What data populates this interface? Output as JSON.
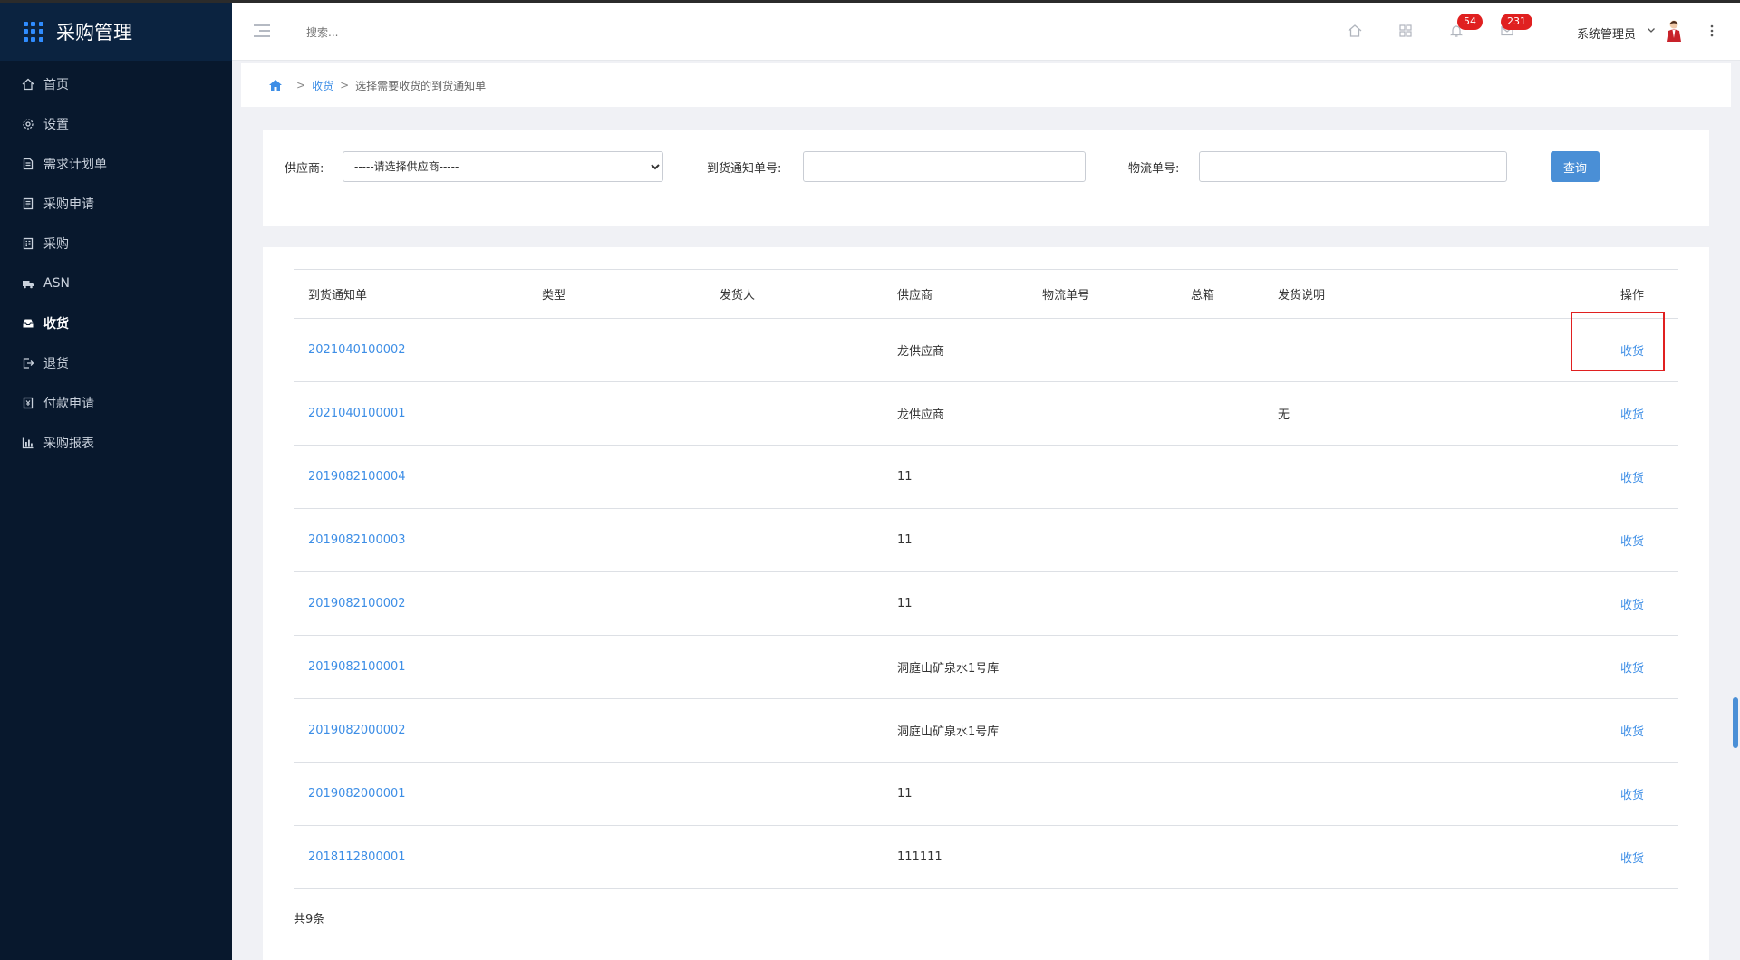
{
  "app": {
    "title": "采购管理"
  },
  "sidebar": {
    "items": [
      {
        "label": "首页",
        "icon": "home-icon"
      },
      {
        "label": "设置",
        "icon": "gear-icon"
      },
      {
        "label": "需求计划单",
        "icon": "doc-icon"
      },
      {
        "label": "采购申请",
        "icon": "form-icon"
      },
      {
        "label": "采购",
        "icon": "list-icon"
      },
      {
        "label": "ASN",
        "icon": "truck-icon"
      },
      {
        "label": "收货",
        "icon": "inbox-icon"
      },
      {
        "label": "退货",
        "icon": "exit-icon"
      },
      {
        "label": "付款申请",
        "icon": "payment-icon"
      },
      {
        "label": "采购报表",
        "icon": "chart-icon"
      }
    ],
    "active": "收货"
  },
  "header": {
    "search_placeholder": "搜索...",
    "notification_count": "54",
    "message_count": "231",
    "user_name": "系统管理员"
  },
  "breadcrumb": {
    "link": "收货",
    "current": "选择需要收货的到货通知单"
  },
  "filter": {
    "supplier_label": "供应商:",
    "supplier_selected": "-----请选择供应商-----",
    "notice_no_label": "到货通知单号:",
    "notice_no_value": "",
    "logistics_no_label": "物流单号:",
    "logistics_no_value": "",
    "query_button": "查询"
  },
  "table": {
    "columns": [
      "到货通知单",
      "类型",
      "发货人",
      "供应商",
      "物流单号",
      "总箱",
      "发货说明",
      "操作"
    ],
    "rows": [
      {
        "notice_no": "2021040100002",
        "type": "",
        "shipper": "",
        "supplier": "龙供应商",
        "logistics_no": "",
        "boxes": "",
        "note": "",
        "action": "收货"
      },
      {
        "notice_no": "2021040100001",
        "type": "",
        "shipper": "",
        "supplier": "龙供应商",
        "logistics_no": "",
        "boxes": "",
        "note": "无",
        "action": "收货"
      },
      {
        "notice_no": "2019082100004",
        "type": "",
        "shipper": "",
        "supplier": "11",
        "logistics_no": "",
        "boxes": "",
        "note": "",
        "action": "收货"
      },
      {
        "notice_no": "2019082100003",
        "type": "",
        "shipper": "",
        "supplier": "11",
        "logistics_no": "",
        "boxes": "",
        "note": "",
        "action": "收货"
      },
      {
        "notice_no": "2019082100002",
        "type": "",
        "shipper": "",
        "supplier": "11",
        "logistics_no": "",
        "boxes": "",
        "note": "",
        "action": "收货"
      },
      {
        "notice_no": "2019082100001",
        "type": "",
        "shipper": "",
        "supplier": "洞庭山矿泉水1号库",
        "logistics_no": "",
        "boxes": "",
        "note": "",
        "action": "收货"
      },
      {
        "notice_no": "2019082000002",
        "type": "",
        "shipper": "",
        "supplier": "洞庭山矿泉水1号库",
        "logistics_no": "",
        "boxes": "",
        "note": "",
        "action": "收货"
      },
      {
        "notice_no": "2019082000001",
        "type": "",
        "shipper": "",
        "supplier": "11",
        "logistics_no": "",
        "boxes": "",
        "note": "",
        "action": "收货"
      },
      {
        "notice_no": "2018112800001",
        "type": "",
        "shipper": "",
        "supplier": "111111",
        "logistics_no": "",
        "boxes": "",
        "note": "",
        "action": "收货"
      }
    ],
    "total": "共9条"
  },
  "colors": {
    "sidebar_bg": "#08182d",
    "brand_bg": "#0b2340",
    "accent": "#3d8ee6",
    "button": "#4a8fd6",
    "badge": "#e02020"
  }
}
